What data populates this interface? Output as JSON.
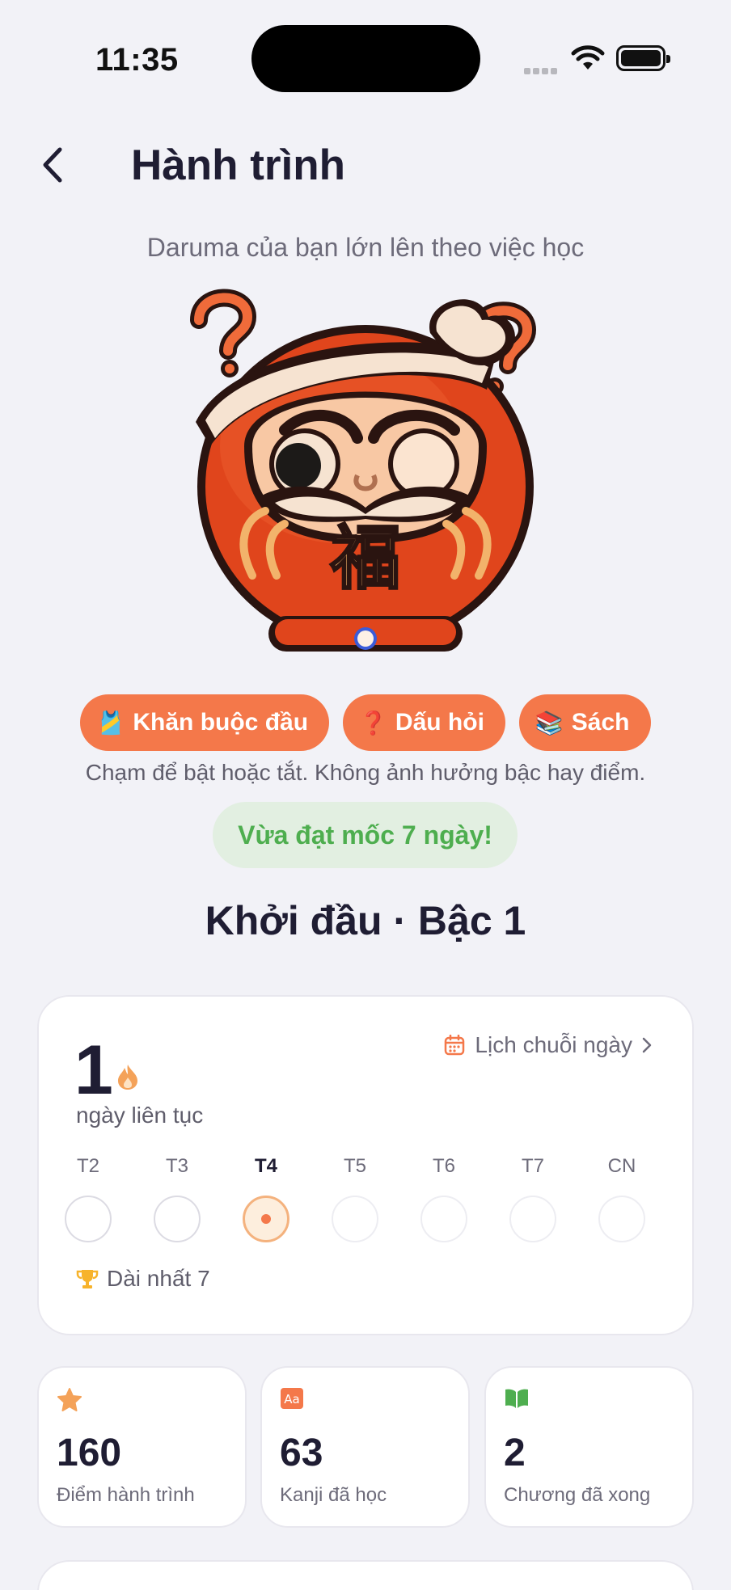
{
  "status_bar": {
    "time": "11:35"
  },
  "header": {
    "title": "Hành trình"
  },
  "subtitle": "Daruma của bạn lớn lên theo việc học",
  "mascot": {
    "name": "daruma",
    "emblem": "福"
  },
  "accessories": [
    {
      "label": "Khăn buộc đầu",
      "icon": "🎽"
    },
    {
      "label": "Dấu hỏi",
      "icon": "❓"
    },
    {
      "label": "Sách",
      "icon": "📚"
    }
  ],
  "accessory_hint": "Chạm để bật hoặc tắt. Không ảnh hưởng bậc hay điểm.",
  "milestone": "Vừa đạt mốc 7 ngày!",
  "level": "Khởi đầu · Bậc 1",
  "streak": {
    "count": "1",
    "label": "ngày liên tục",
    "calendar_link": "Lịch chuỗi ngày",
    "days": [
      "T2",
      "T3",
      "T4",
      "T5",
      "T6",
      "T7",
      "CN"
    ],
    "today_index": 2,
    "longest": "Dài nhất 7"
  },
  "stats": [
    {
      "value": "160",
      "label": "Điểm hành trình",
      "icon": "star-icon",
      "color": "#f4a259"
    },
    {
      "value": "63",
      "label": "Kanji đã học",
      "icon": "kanji-icon",
      "color": "#f4784a"
    },
    {
      "value": "2",
      "label": "Chương đã xong",
      "icon": "book-icon",
      "color": "#4eae4f"
    }
  ],
  "colors": {
    "accent": "#f4784a",
    "success": "#4eae4f",
    "background": "#f2f2f7"
  }
}
